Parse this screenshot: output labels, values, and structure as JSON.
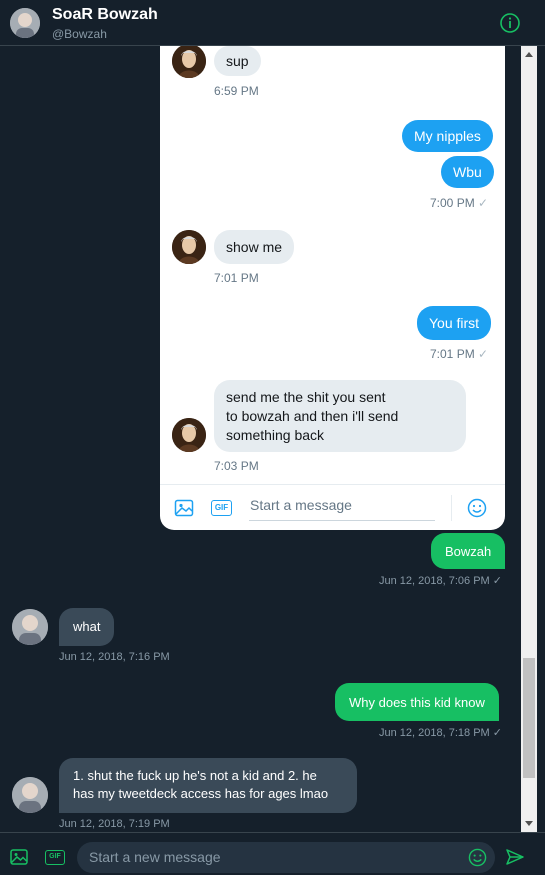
{
  "header": {
    "name": "SoaR Bowzah",
    "handle": "@Bowzah",
    "icons": {
      "avatar": "avatar",
      "info": "info-icon"
    }
  },
  "embedded": {
    "messages": [
      {
        "dir": "in",
        "text": "sup"
      },
      {
        "time": "6:59 PM"
      },
      {
        "dir": "out",
        "text": "My nipples"
      },
      {
        "dir": "out",
        "text": "Wbu"
      },
      {
        "time": "7:00 PM",
        "check": "✓"
      },
      {
        "dir": "in",
        "text": "show me"
      },
      {
        "time": "7:01 PM"
      },
      {
        "dir": "out",
        "text": "You first"
      },
      {
        "time": "7:01 PM",
        "check": "✓"
      },
      {
        "dir": "in",
        "lines": [
          "send me the shit you sent",
          "to bowzah and then i'll send",
          "something back"
        ]
      },
      {
        "time": "7:03 PM"
      }
    ],
    "composer": {
      "placeholder": "Start a message"
    }
  },
  "thread": [
    {
      "dir": "out",
      "text": "Bowzah",
      "stamp": "Jun 12, 2018, 7:06 PM ✓"
    },
    {
      "dir": "in",
      "text": "what",
      "stamp": "Jun 12, 2018, 7:16 PM"
    },
    {
      "dir": "out",
      "text": "Why does this kid know",
      "stamp": "Jun 12, 2018, 7:18 PM ✓"
    },
    {
      "dir": "in",
      "lines": [
        "1. shut the fuck up he's not a kid and 2. he",
        "has my tweetdeck access has for ages lmao"
      ],
      "stamp": "Jun 12, 2018, 7:19 PM"
    }
  ],
  "composer": {
    "placeholder": "Start a new message",
    "gif_label": "GIF"
  },
  "colors": {
    "bg": "#15202b",
    "accent": "#17bf63",
    "twitter_blue": "#1da1f2"
  }
}
